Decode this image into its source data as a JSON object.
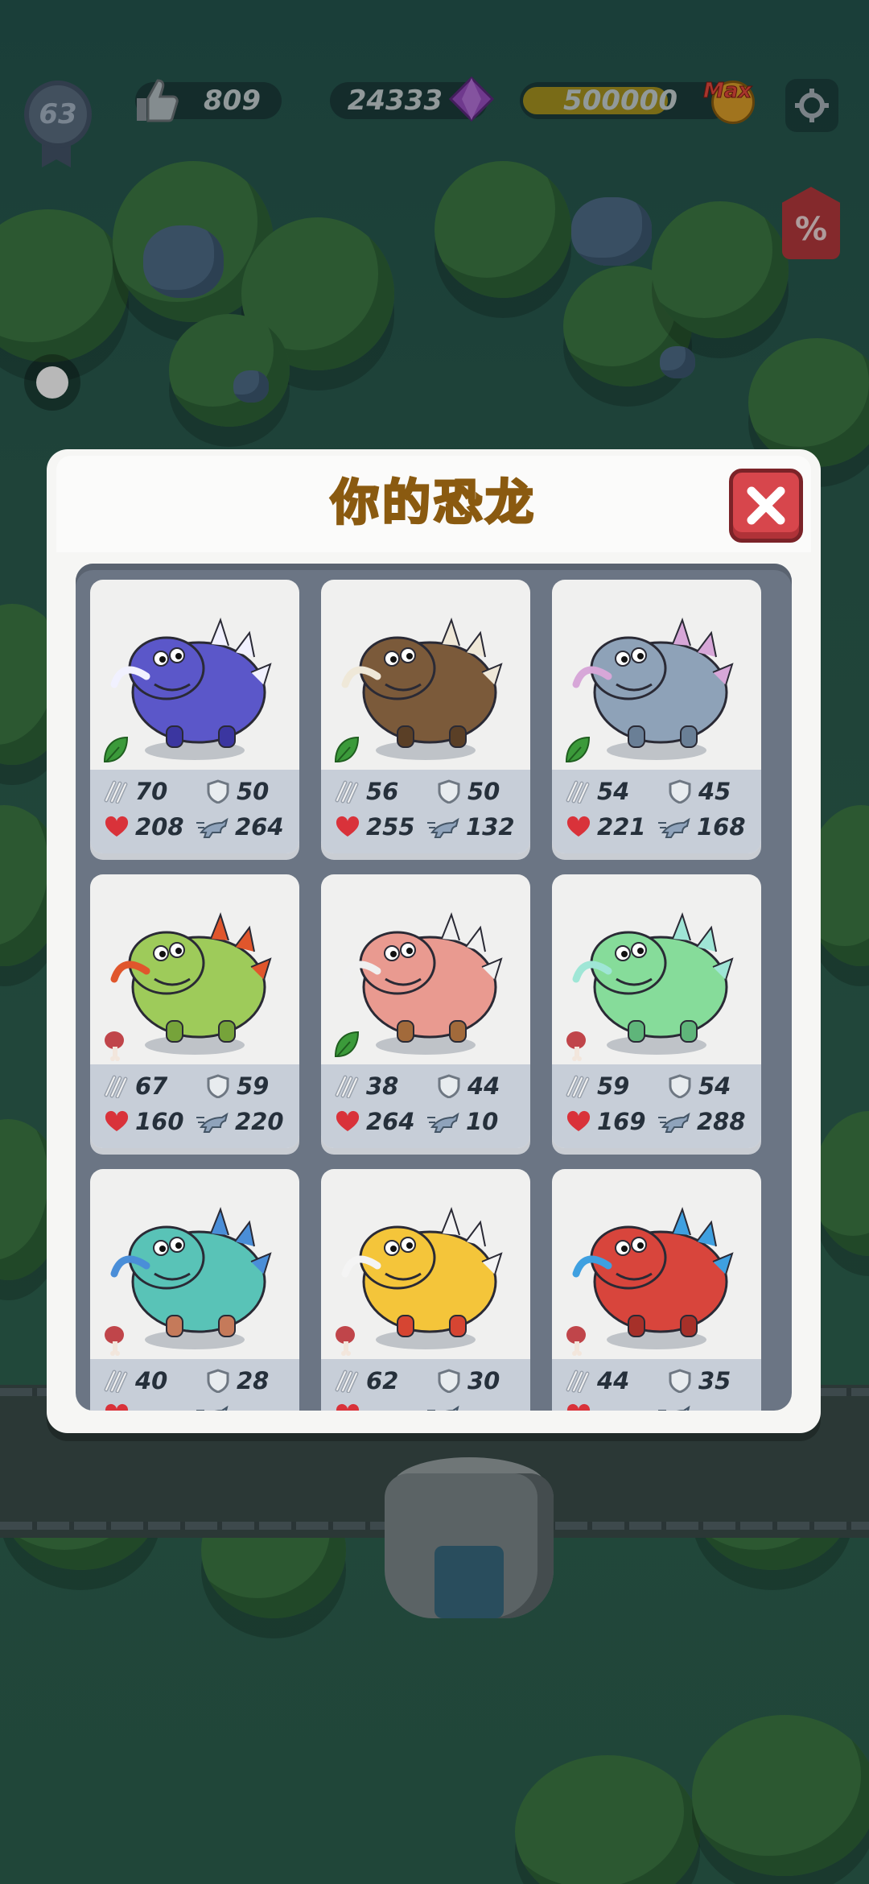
{
  "hud": {
    "level": "63",
    "likes": "809",
    "gems": "24333",
    "coins": "500000",
    "coins_badge": "Max",
    "sale_label": "%"
  },
  "dialog": {
    "title": "你的恐龙"
  },
  "dinos": [
    {
      "name": "purple-triceratops",
      "type": "herbivore",
      "attack": "70",
      "defense": "50",
      "health": "208",
      "speed": "264"
    },
    {
      "name": "brown-furry-mammoth",
      "type": "herbivore",
      "attack": "56",
      "defense": "50",
      "health": "255",
      "speed": "132"
    },
    {
      "name": "grey-plesiosaur",
      "type": "herbivore",
      "attack": "54",
      "defense": "45",
      "health": "221",
      "speed": "168"
    },
    {
      "name": "green-trex",
      "type": "carnivore",
      "attack": "67",
      "defense": "59",
      "health": "160",
      "speed": "220"
    },
    {
      "name": "ammonite-snail",
      "type": "herbivore",
      "attack": "38",
      "defense": "44",
      "health": "264",
      "speed": "10"
    },
    {
      "name": "mint-stegosaur",
      "type": "carnivore",
      "attack": "59",
      "defense": "54",
      "health": "169",
      "speed": "288"
    },
    {
      "name": "teal-multiarm-monster",
      "type": "carnivore",
      "attack": "40",
      "defense": "28",
      "health": "",
      "speed": ""
    },
    {
      "name": "yellow-sabertooth",
      "type": "carnivore",
      "attack": "62",
      "defense": "30",
      "health": "",
      "speed": ""
    },
    {
      "name": "red-unicorn-blob",
      "type": "carnivore",
      "attack": "44",
      "defense": "35",
      "health": "",
      "speed": ""
    }
  ],
  "colors": {
    "title": "#f2b01c",
    "close_button": "#d7464c",
    "herbivore_icon": "#3b9a3a",
    "carnivore_icon": "#c0454a",
    "heart": "#d9323a",
    "gem": "#9a4fc4"
  }
}
